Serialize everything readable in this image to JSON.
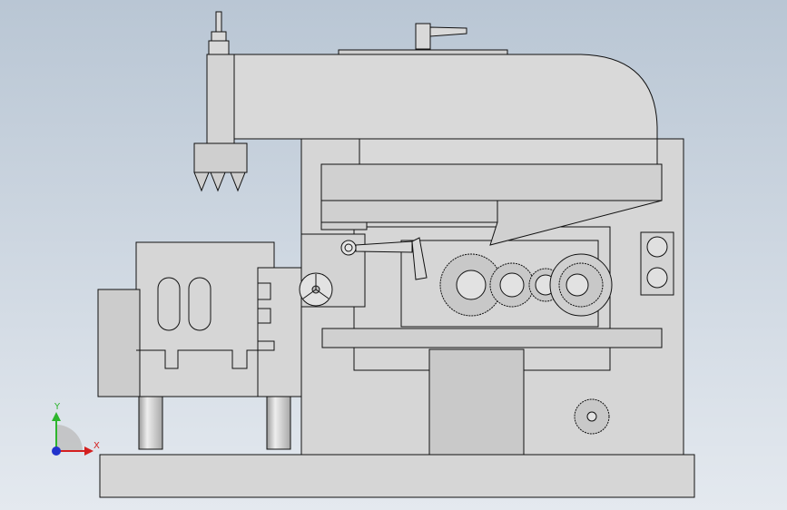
{
  "viewport": {
    "background_top": "#b9c6d4",
    "background_bottom": "#e4e9ef",
    "colors": {
      "body": "#d6d6d6",
      "body_dark": "#c4c4c4",
      "ram": "#d9d9d9",
      "gear": "#c8c8c8",
      "outline": "#111111"
    }
  },
  "triad": {
    "y_label": "Y",
    "x_label": "X",
    "y_color": "#2db52d",
    "x_color": "#d42020",
    "z_color": "#2233cc"
  }
}
